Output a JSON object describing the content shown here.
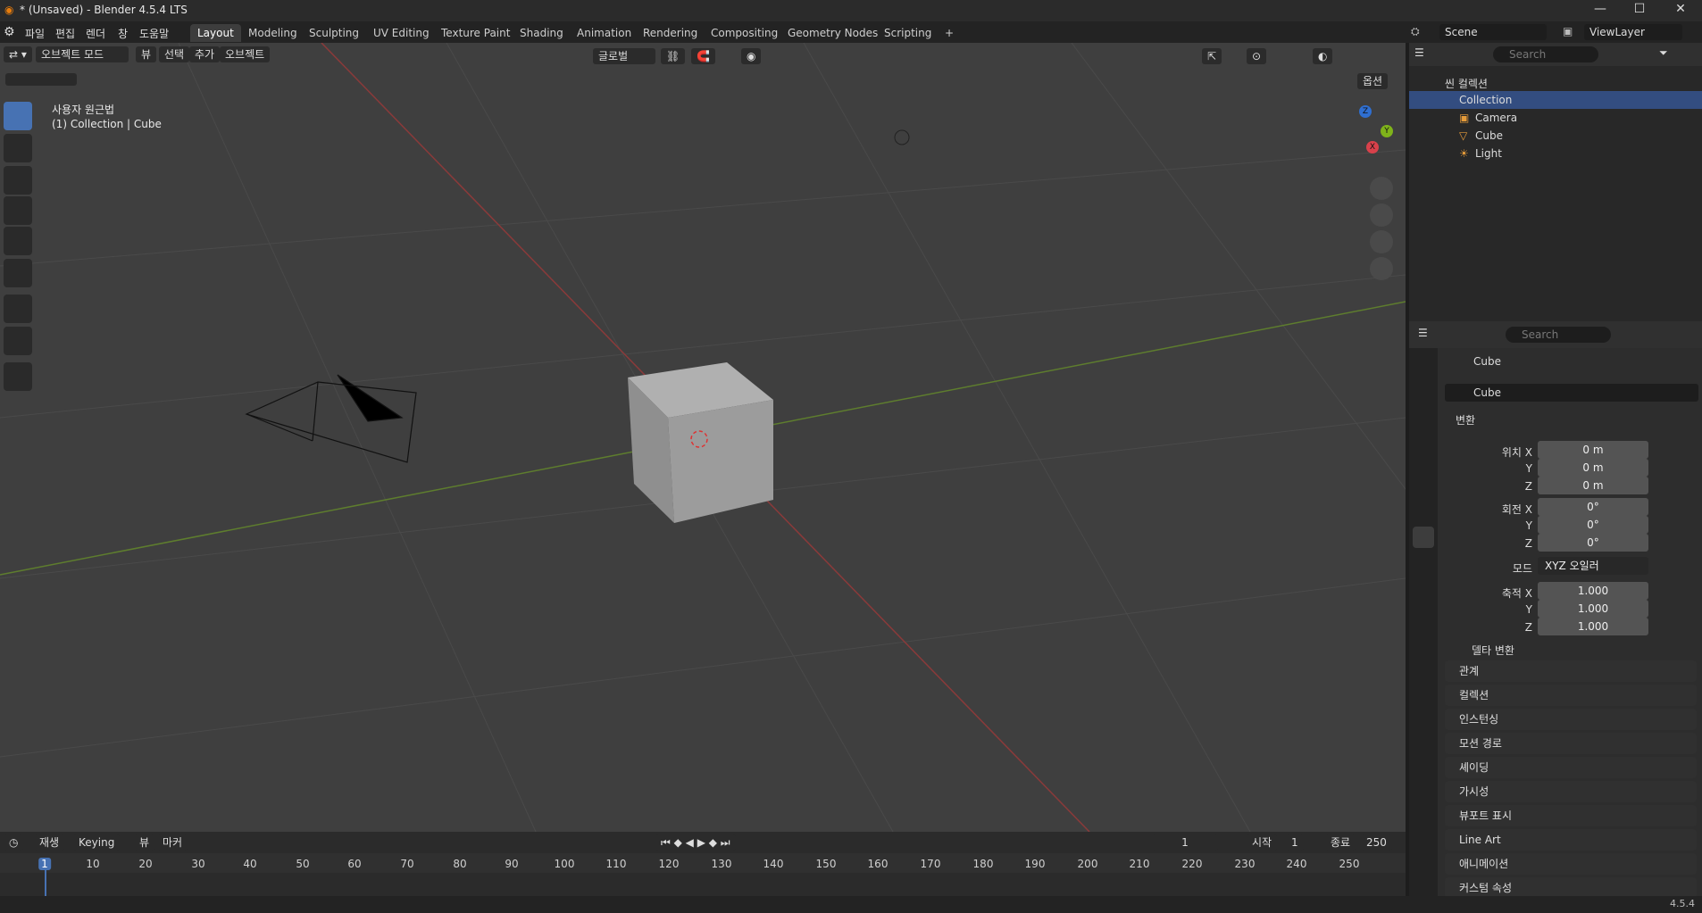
{
  "window": {
    "title": "* (Unsaved) - Blender 4.5.4 LTS",
    "controls": [
      "—",
      "☐",
      "✕"
    ]
  },
  "menu": [
    "파일",
    "편집",
    "렌더",
    "창",
    "도움말"
  ],
  "workspaces": [
    "Layout",
    "Modeling",
    "Sculpting",
    "UV Editing",
    "Texture Paint",
    "Shading",
    "Animation",
    "Rendering",
    "Compositing",
    "Geometry Nodes",
    "Scripting"
  ],
  "active_workspace": "Layout",
  "scene": {
    "label": "Scene",
    "view_layer": "ViewLayer"
  },
  "viewport": {
    "mode": "오브젝트 모드",
    "menus": [
      "뷰",
      "선택",
      "추가",
      "오브젝트"
    ],
    "transform_orientation": "글로벌",
    "options": "옵션",
    "view_name": "사용자 원근법",
    "context": "(1) Collection | Cube"
  },
  "gizmo": {
    "x": "X",
    "y": "Y",
    "z": "Z"
  },
  "outliner": {
    "search_placeholder": "Search",
    "root": "씬 컬렉션",
    "collection": "Collection",
    "objects": [
      "Camera",
      "Cube",
      "Light"
    ]
  },
  "properties": {
    "search_placeholder": "Search",
    "object_name": "Cube",
    "object_field": "Cube",
    "transform_header": "변환",
    "location_label": "위치 X",
    "rotation_label": "회전 X",
    "scale_label": "축적 X",
    "axis_y": "Y",
    "axis_z": "Z",
    "location": [
      "0 m",
      "0 m",
      "0 m"
    ],
    "rotation": [
      "0°",
      "0°",
      "0°"
    ],
    "mode_label": "모드",
    "mode_value": "XYZ 오일러",
    "scale": [
      "1.000",
      "1.000",
      "1.000"
    ],
    "delta_transform": "델타 변환",
    "panels": [
      "관계",
      "컬렉션",
      "인스턴싱",
      "모션 경로",
      "셰이딩",
      "가시성",
      "뷰포트 표시",
      "Line Art",
      "애니메이션",
      "커스텀 속성"
    ]
  },
  "timeline": {
    "playback": "재생",
    "keying": "Keying",
    "view": "뷰",
    "marker": "마커",
    "current_frame": "1",
    "start_label": "시작",
    "start": "1",
    "end_label": "종료",
    "end": "250",
    "ticks": [
      "1",
      "10",
      "20",
      "30",
      "40",
      "50",
      "60",
      "70",
      "80",
      "90",
      "100",
      "110",
      "120",
      "130",
      "140",
      "150",
      "160",
      "170",
      "180",
      "190",
      "200",
      "210",
      "220",
      "230",
      "240",
      "250"
    ]
  },
  "status": {
    "version": "4.5.4"
  }
}
